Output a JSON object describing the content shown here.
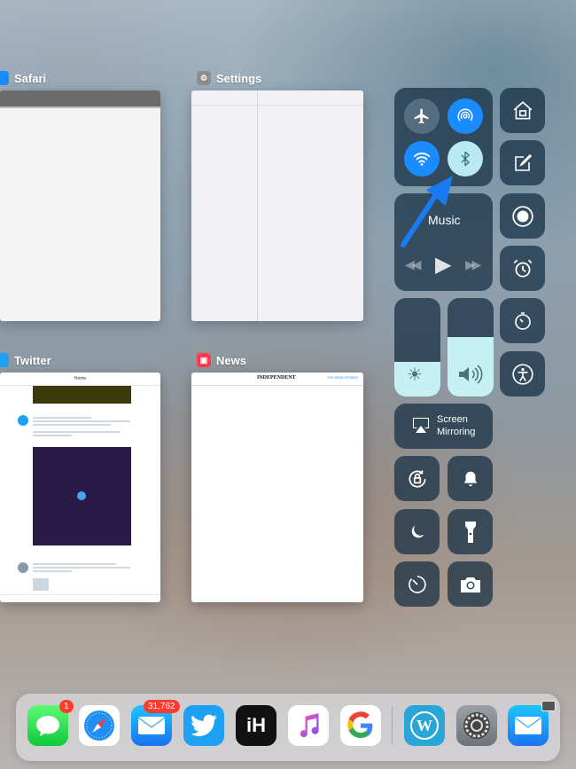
{
  "app_switcher": {
    "cards": [
      {
        "id": "safari",
        "title": "Safari"
      },
      {
        "id": "settings",
        "title": "Settings"
      },
      {
        "id": "twitter",
        "title": "Twitter",
        "home_label": "Home"
      },
      {
        "id": "news",
        "title": "News",
        "masthead": "INDEPENDENT",
        "top_news": "TOP NEWS STORIES"
      }
    ]
  },
  "control_center": {
    "music_label": "Music",
    "screen_mirroring_label": "Screen\nMirroring",
    "brightness_level": 0.35,
    "volume_level": 0.6
  },
  "dock": {
    "apps": [
      {
        "name": "Messages",
        "badge": "1"
      },
      {
        "name": "Safari"
      },
      {
        "name": "Mail",
        "badge": "31,762"
      },
      {
        "name": "Twitter"
      },
      {
        "name": "iH"
      },
      {
        "name": "Music"
      },
      {
        "name": "Google"
      },
      {
        "name": "WordPress"
      },
      {
        "name": "Settings"
      },
      {
        "name": "Mail"
      }
    ],
    "ih_label": "iH"
  },
  "colors": {
    "accent_blue": "#1a8cff",
    "tile_dark": "rgba(20,45,65,0.72)",
    "bluetooth_on": "#b9e9f2"
  }
}
